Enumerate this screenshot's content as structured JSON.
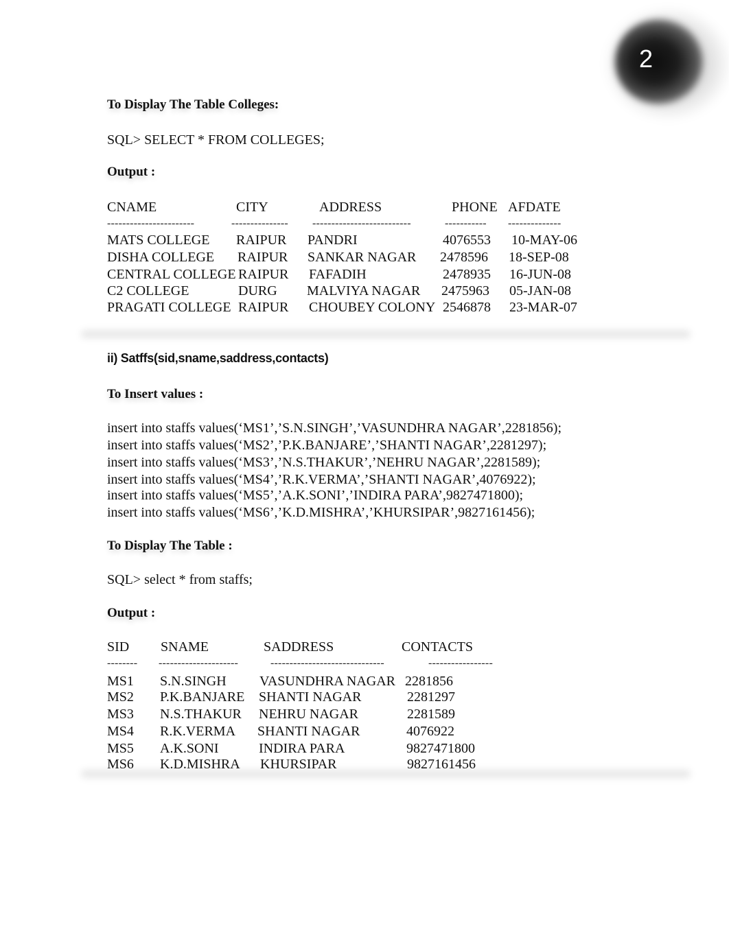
{
  "page_number": "2",
  "colleges_section": {
    "heading": "To Display The Table Colleges:",
    "sql": "SQL> SELECT * FROM COLLEGES;",
    "output_label": "Output :",
    "table": {
      "columns": [
        "CNAME",
        "CITY",
        "ADDRESS",
        "PHONE",
        "AFDATE"
      ],
      "dashes": [
        "-----------------------",
        "---------------",
        "--------------------------",
        "-----------",
        "--------------"
      ],
      "rows": [
        [
          "MATS COLLEGE",
          "RAIPUR",
          "PANDRI",
          "4076553",
          "10-MAY-06"
        ],
        [
          "DISHA COLLEGE",
          "RAIPUR",
          "SANKAR NAGAR",
          "2478596",
          "18-SEP-08"
        ],
        [
          "CENTRAL COLLEGE",
          "RAIPUR",
          "FAFADIH",
          "2478935",
          "16-JUN-08"
        ],
        [
          "C2 COLLEGE",
          "DURG",
          "MALVIYA NAGAR",
          "2475963",
          "05-JAN-08"
        ],
        [
          "PRAGATI COLLEGE",
          "RAIPUR",
          "CHOUBEY COLONY",
          "2546878",
          "23-MAR-07"
        ]
      ]
    }
  },
  "staffs_section": {
    "subheading": "ii) Satffs(sid,sname,saddress,contacts)",
    "insert_heading": "To Insert values :",
    "insert_statements": [
      "insert into staffs values(‘MS1’,’S.N.SINGH’,’VASUNDHRA NAGAR’,2281856);",
      "insert into staffs values(‘MS2’,’P.K.BANJARE’,’SHANTI NAGAR’,2281297);",
      "insert into staffs values(‘MS3’,’N.S.THAKUR’,’NEHRU NAGAR’,2281589);",
      "insert into staffs values(‘MS4’,’R.K.VERMA’,’SHANTI NAGAR’,4076922);",
      "insert into staffs values(‘MS5’,’A.K.SONI’,’INDIRA PARA’,9827471800);",
      "insert into staffs values(‘MS6’,’K.D.MISHRA’,’KHURSIPAR’,9827161456);"
    ],
    "display_heading": "To Display The Table :",
    "sql": "SQL> select * from staffs;",
    "output_label": "Output :",
    "table": {
      "columns": [
        "SID",
        "SNAME",
        "SADDRESS",
        "CONTACTS"
      ],
      "dashes": [
        "--------",
        "---------------------",
        "------------------------------",
        "-----------------"
      ],
      "rows": [
        [
          "MS1",
          "S.N.SINGH",
          "VASUNDHRA NAGAR",
          "2281856"
        ],
        [
          "MS2",
          "P.K.BANJARE",
          "SHANTI NAGAR",
          "2281297"
        ],
        [
          "MS3",
          "N.S.THAKUR",
          "NEHRU NAGAR",
          "2281589"
        ],
        [
          "MS4",
          "R.K.VERMA",
          "SHANTI NAGAR",
          "4076922"
        ],
        [
          "MS5",
          "A.K.SONI",
          "INDIRA PARA",
          "9827471800"
        ],
        [
          "MS6",
          "K.D.MISHRA",
          "KHURSIPAR",
          "9827161456"
        ]
      ]
    }
  }
}
